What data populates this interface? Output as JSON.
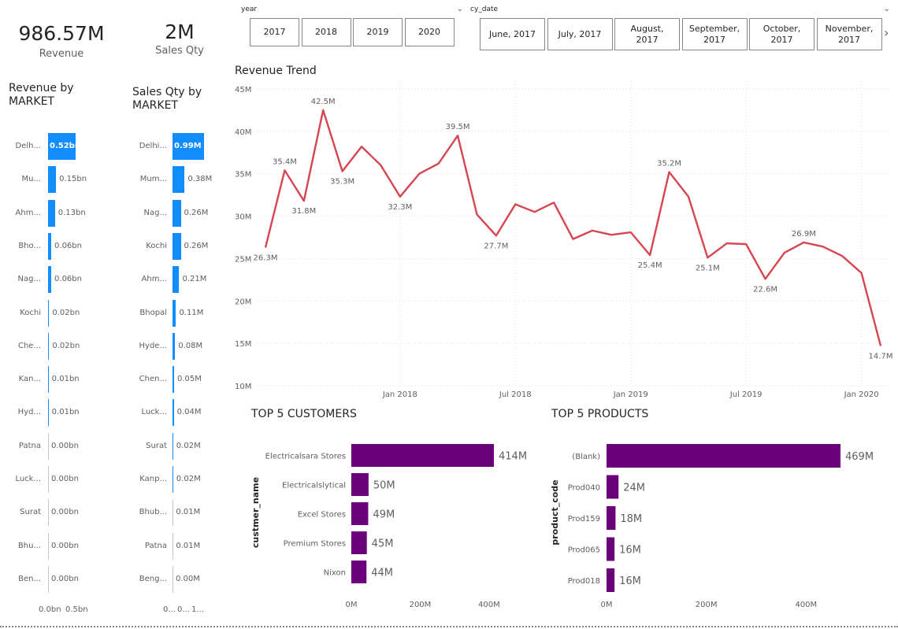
{
  "kpis": {
    "revenue": {
      "value": "986.57M",
      "label": "Revenue"
    },
    "sales_qty": {
      "value": "2M",
      "label": "Sales Qty"
    }
  },
  "year_slicer": {
    "title": "year",
    "options": [
      "2017",
      "2018",
      "2019",
      "2020"
    ]
  },
  "date_slicer": {
    "title": "cy_date",
    "options": [
      "June, 2017",
      "July, 2017",
      "August,\n2017",
      "September,\n2017",
      "October,\n2017",
      "November,\n2017"
    ]
  },
  "revenue_by_market": {
    "title": "Revenue by MARKET",
    "categories": [
      "Delh...",
      "Mu...",
      "Ahm...",
      "Bho...",
      "Nag...",
      "Kochi",
      "Che...",
      "Kan...",
      "Hyd...",
      "Patna",
      "Luck...",
      "Surat",
      "Bhu...",
      "Ben..."
    ],
    "values": [
      0.52,
      0.15,
      0.13,
      0.06,
      0.06,
      0.02,
      0.02,
      0.01,
      0.01,
      0.0,
      0.0,
      0.0,
      0.0,
      0.0
    ],
    "labels": [
      "0.52bn",
      "0.15bn",
      "0.13bn",
      "0.06bn",
      "0.06bn",
      "0.02bn",
      "0.02bn",
      "0.01bn",
      "0.01bn",
      "0.00bn",
      "0.00bn",
      "0.00bn",
      "0.00bn",
      "0.00bn"
    ],
    "axis_ticks": [
      "0.0bn",
      "0.5bn"
    ],
    "max": 0.52,
    "color": "#118dff"
  },
  "sales_by_market": {
    "title": "Sales Qty by MARKET",
    "categories": [
      "Delhi...",
      "Mum...",
      "Nag...",
      "Kochi",
      "Ahm...",
      "Bhopal",
      "Hyde...",
      "Chen...",
      "Luck...",
      "Surat",
      "Kanp...",
      "Bhub...",
      "Patna",
      "Beng..."
    ],
    "values": [
      0.99,
      0.38,
      0.26,
      0.26,
      0.21,
      0.11,
      0.08,
      0.05,
      0.04,
      0.02,
      0.02,
      0.01,
      0.01,
      0.0
    ],
    "labels": [
      "0.99M",
      "0.38M",
      "0.26M",
      "0.26M",
      "0.21M",
      "0.11M",
      "0.08M",
      "0.05M",
      "0.04M",
      "0.02M",
      "0.02M",
      "0.01M",
      "0.01M",
      "0.00M"
    ],
    "axis_ticks": [
      "0...",
      "0...",
      "1..."
    ],
    "max": 0.99,
    "color": "#118dff"
  },
  "chart_data": [
    {
      "type": "line",
      "title": "Revenue Trend",
      "color": "#d64550",
      "y_ticks": [
        "45M",
        "40M",
        "35M",
        "30M",
        "25M",
        "20M",
        "15M",
        "10M"
      ],
      "ylim": [
        10,
        45
      ],
      "x_ticks": [
        "Jan 2018",
        "Jul 2018",
        "Jan 2019",
        "Jul 2019",
        "Jan 2020"
      ],
      "x_tick_index": [
        7,
        13,
        19,
        25,
        31
      ],
      "x": [
        "2017-06",
        "2017-07",
        "2017-08",
        "2017-09",
        "2017-10",
        "2017-11",
        "2017-12",
        "2018-01",
        "2018-02",
        "2018-03",
        "2018-04",
        "2018-05",
        "2018-06",
        "2018-07",
        "2018-08",
        "2018-09",
        "2018-10",
        "2018-11",
        "2018-12",
        "2019-01",
        "2019-02",
        "2019-03",
        "2019-04",
        "2019-05",
        "2019-06",
        "2019-07",
        "2019-08",
        "2019-09",
        "2019-10",
        "2019-11",
        "2019-12",
        "2020-01",
        "2020-02",
        "2020-03",
        "2020-04",
        "2020-05",
        "2020-06"
      ],
      "values": [
        26.3,
        35.4,
        31.8,
        42.5,
        35.3,
        38.2,
        36.0,
        32.3,
        35.0,
        36.2,
        39.5,
        30.2,
        27.7,
        31.4,
        30.5,
        31.6,
        27.3,
        28.3,
        27.8,
        28.1,
        25.4,
        35.2,
        32.3,
        25.1,
        26.8,
        26.7,
        22.6,
        25.7,
        26.9,
        26.4,
        25.3,
        23.3,
        14.7
      ],
      "data_labels": [
        {
          "i": 0,
          "text": "26.3M",
          "pos": "below"
        },
        {
          "i": 1,
          "text": "35.4M",
          "pos": "above"
        },
        {
          "i": 2,
          "text": "31.8M",
          "pos": "below"
        },
        {
          "i": 3,
          "text": "42.5M",
          "pos": "above"
        },
        {
          "i": 4,
          "text": "35.3M",
          "pos": "below"
        },
        {
          "i": 7,
          "text": "32.3M",
          "pos": "below"
        },
        {
          "i": 10,
          "text": "39.5M",
          "pos": "above"
        },
        {
          "i": 12,
          "text": "27.7M",
          "pos": "below"
        },
        {
          "i": 20,
          "text": "25.4M",
          "pos": "below"
        },
        {
          "i": 21,
          "text": "35.2M",
          "pos": "above"
        },
        {
          "i": 23,
          "text": "25.1M",
          "pos": "below"
        },
        {
          "i": 26,
          "text": "22.6M",
          "pos": "below"
        },
        {
          "i": 28,
          "text": "26.9M",
          "pos": "above"
        },
        {
          "i": 32,
          "text": "14.7M",
          "pos": "below"
        }
      ]
    },
    {
      "type": "bar",
      "title": "TOP 5 CUSTOMERS",
      "ylabel": "custmer_name",
      "categories": [
        "Electricalsara Stores",
        "Electricalslytical",
        "Excel Stores",
        "Premium Stores",
        "Nixon"
      ],
      "values": [
        414,
        50,
        49,
        45,
        44
      ],
      "labels": [
        "414M",
        "50M",
        "49M",
        "45M",
        "44M"
      ],
      "x_ticks": [
        "0M",
        "200M",
        "400M"
      ],
      "x_tick_values": [
        0,
        200,
        400
      ],
      "xlim": [
        0,
        414
      ],
      "color": "#6b007b"
    },
    {
      "type": "bar",
      "title": "TOP 5 PRODUCTS",
      "ylabel": "product_code",
      "categories": [
        "(Blank)",
        "Prod040",
        "Prod159",
        "Prod065",
        "Prod018"
      ],
      "values": [
        469,
        24,
        18,
        16,
        16
      ],
      "labels": [
        "469M",
        "24M",
        "18M",
        "16M",
        "16M"
      ],
      "x_ticks": [
        "0M",
        "200M",
        "400M"
      ],
      "x_tick_values": [
        0,
        200,
        400
      ],
      "xlim": [
        0,
        469
      ],
      "color": "#6b007b"
    }
  ]
}
